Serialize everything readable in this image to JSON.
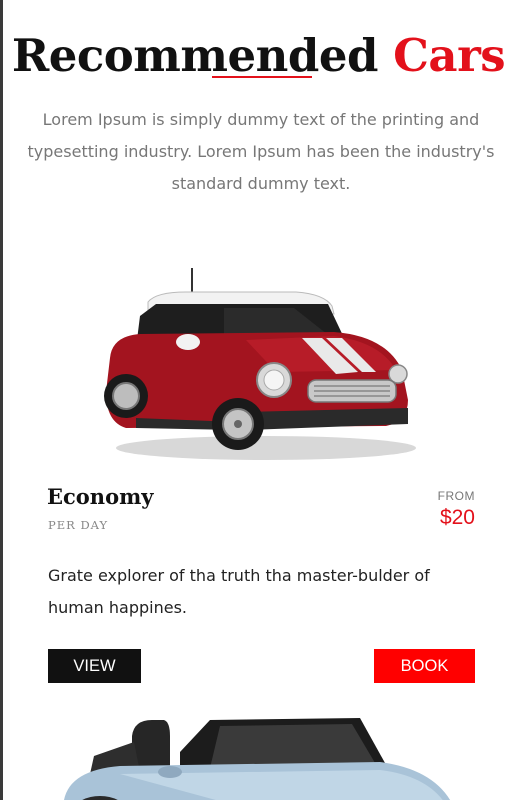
{
  "section": {
    "heading_main": "Recommended",
    "heading_accent": "Cars",
    "intro": "Lorem Ipsum is simply dummy text of the printing and typesetting industry. Lorem Ipsum has been the industry's standard dummy text."
  },
  "cars": [
    {
      "title": "Economy",
      "period": "PER DAY",
      "from_label": "FROM",
      "price": "$20",
      "description": "Grate explorer of tha truth tha master-bulder of human happines.",
      "view_label": "VIEW",
      "book_label": "BOOK",
      "image_icon": "red-hatchback-car-image",
      "body_color": "#a3141f"
    },
    {
      "image_icon": "blue-convertible-car-image",
      "body_color": "#a9c3d8"
    }
  ],
  "colors": {
    "accent": "#e3111b",
    "button_dark": "#111111",
    "button_red": "#ff0000",
    "muted_text": "#777777"
  }
}
